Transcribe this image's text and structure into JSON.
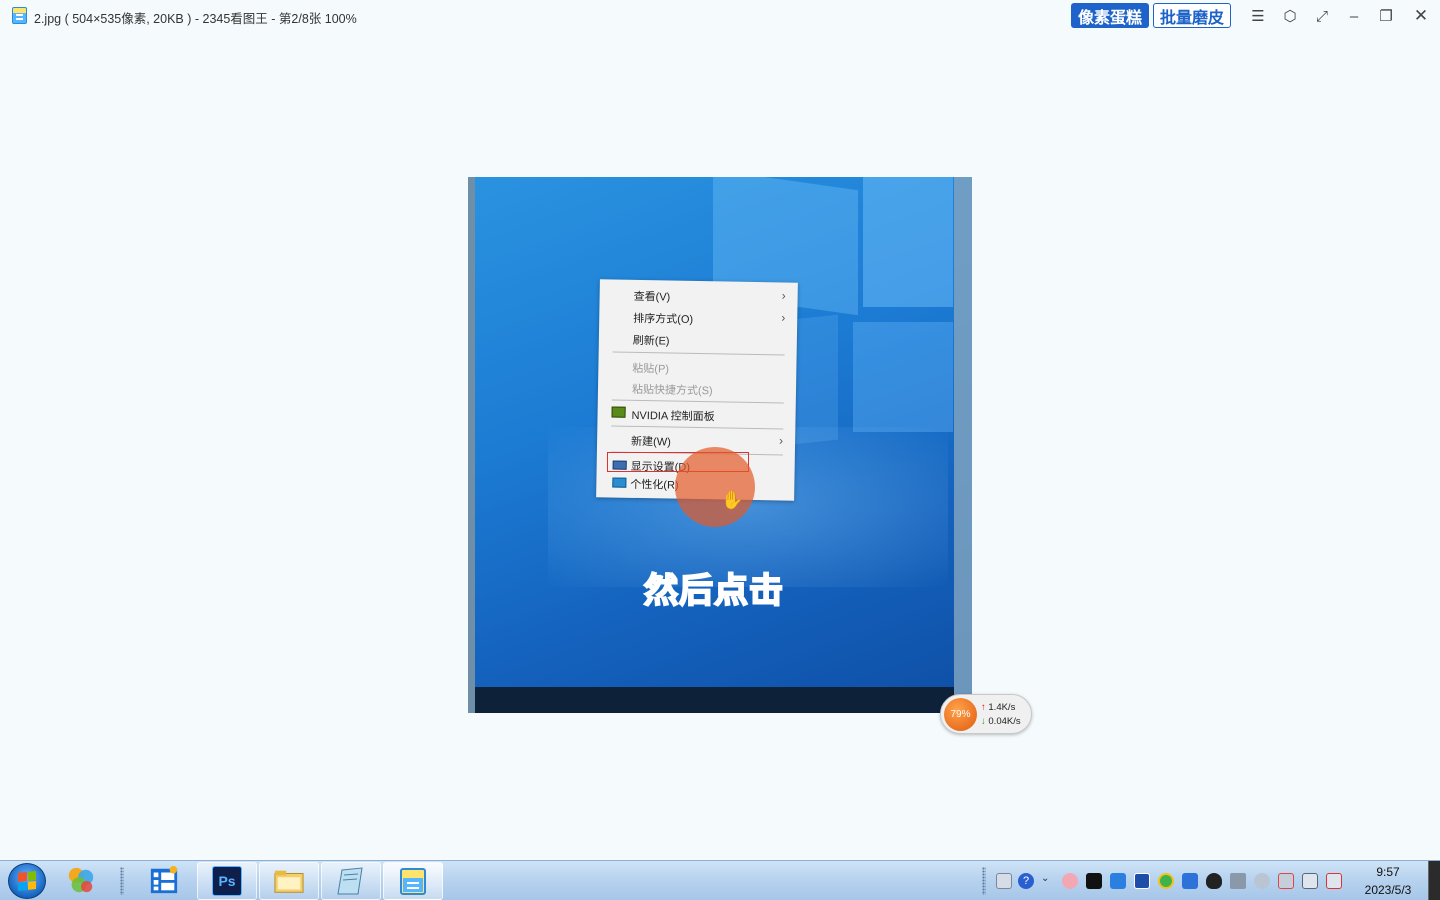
{
  "window": {
    "title": "2.jpg ( 504×535像素, 20KB ) - 2345看图王 - 第2/8张 100%",
    "btn_pixel_cake": "像素蛋糕",
    "btn_batch_peel": "批量磨皮"
  },
  "photo": {
    "context_menu": {
      "items": [
        {
          "label": "查看(V)",
          "arrow": "›",
          "enabled": true
        },
        {
          "label": "排序方式(O)",
          "arrow": "›",
          "enabled": true
        },
        {
          "label": "刷新(E)",
          "enabled": true
        },
        {
          "label": "粘贴(P)",
          "enabled": false
        },
        {
          "label": "粘贴快捷方式(S)",
          "enabled": false
        },
        {
          "label": "NVIDIA 控制面板",
          "enabled": true
        },
        {
          "label": "新建(W)",
          "arrow": "›",
          "enabled": true
        },
        {
          "label": "显示设置(D)",
          "enabled": true,
          "highlighted": true
        },
        {
          "label": "个性化(R)",
          "enabled": true
        }
      ]
    },
    "caption": "然后点击"
  },
  "net_widget": {
    "percent": "79%",
    "upload": "1.4K/s",
    "download": "0.04K/s"
  },
  "taskbar": {
    "apps": [
      "start-orb",
      "color-balls",
      "film-app",
      "photoshop",
      "file-explorer",
      "notepad",
      "2345-viewer"
    ],
    "ps_label": "Ps",
    "time": "9:57",
    "date": "2023/5/3"
  },
  "colors": {
    "accent": "#1d63c9",
    "highlight_border": "#e03030",
    "caption": "#8a2216"
  }
}
